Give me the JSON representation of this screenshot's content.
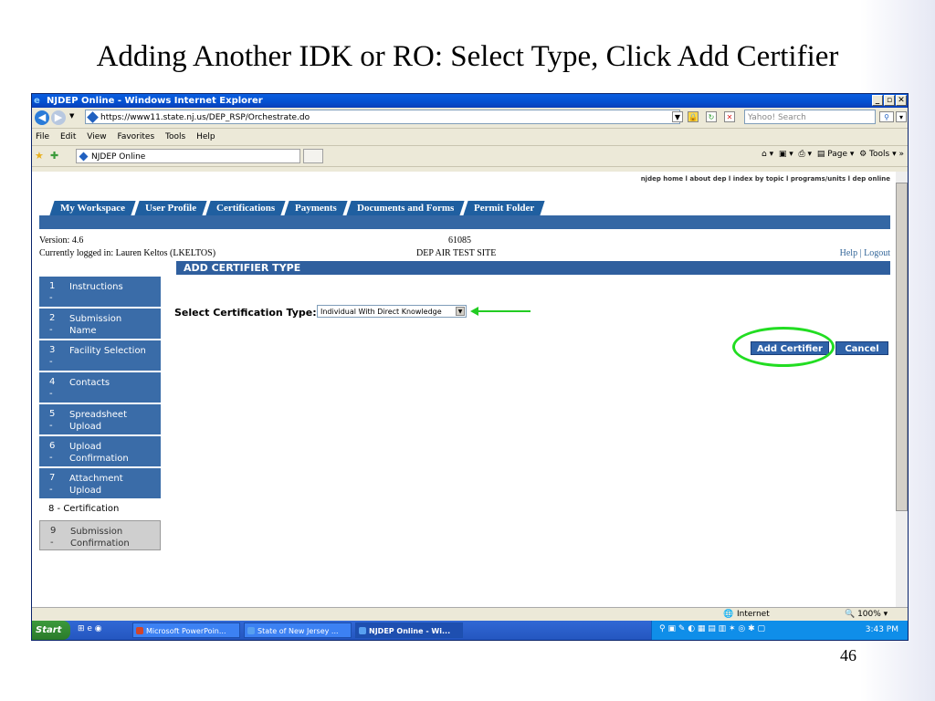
{
  "slide": {
    "title": "Adding Another IDK or RO: Select Type, Click Add Certifier",
    "page_number": "46"
  },
  "browser": {
    "window_title": "NJDEP Online - Windows Internet Explorer",
    "url": "https://www11.state.nj.us/DEP_RSP/Orchestrate.do",
    "search_placeholder": "Yahoo! Search",
    "menu": [
      "File",
      "Edit",
      "View",
      "Favorites",
      "Tools",
      "Help"
    ],
    "tab_title": "NJDEP Online",
    "command_page": "Page",
    "command_tools": "Tools"
  },
  "site": {
    "top_links": "njdep home  l  about dep  l  index by topic  l  programs/units  l  dep online",
    "tabs": [
      "My Workspace",
      "User Profile",
      "Certifications",
      "Payments",
      "Documents and Forms",
      "Permit Folder"
    ],
    "version": "Version: 4.6",
    "session_id": "61085",
    "logged_in": "Currently logged in: Lauren Keltos (LKELTOS)",
    "site_name": "DEP AIR TEST SITE",
    "help_link": "Help",
    "separator": "|",
    "logout_link": "Logout",
    "section_title": "ADD CERTIFIER TYPE",
    "steps": [
      {
        "num": "1",
        "label": "Instructions"
      },
      {
        "num": "2",
        "label": "Submission Name"
      },
      {
        "num": "3",
        "label": "Facility Selection"
      },
      {
        "num": "4",
        "label": "Contacts"
      },
      {
        "num": "5",
        "label": "Spreadsheet Upload"
      },
      {
        "num": "6",
        "label": "Upload Confirmation"
      },
      {
        "num": "7",
        "label": "Attachment Upload"
      },
      {
        "num": "8",
        "label": "Certification"
      },
      {
        "num": "9",
        "label": "Submission Confirmation"
      }
    ],
    "step_dash": "-",
    "current_step_text": "8  -  Certification",
    "cert_type_label": "Select Certification Type:",
    "cert_type_value": "Individual With Direct Knowledge",
    "add_certifier": "Add Certifier",
    "cancel": "Cancel"
  },
  "status": {
    "zone": "Internet",
    "zoom": "100%"
  },
  "taskbar": {
    "start": "Start",
    "tasks": [
      "Microsoft PowerPoin...",
      "State of New Jersey ...",
      "NJDEP Online - Wi..."
    ],
    "clock": "3:43 PM"
  }
}
